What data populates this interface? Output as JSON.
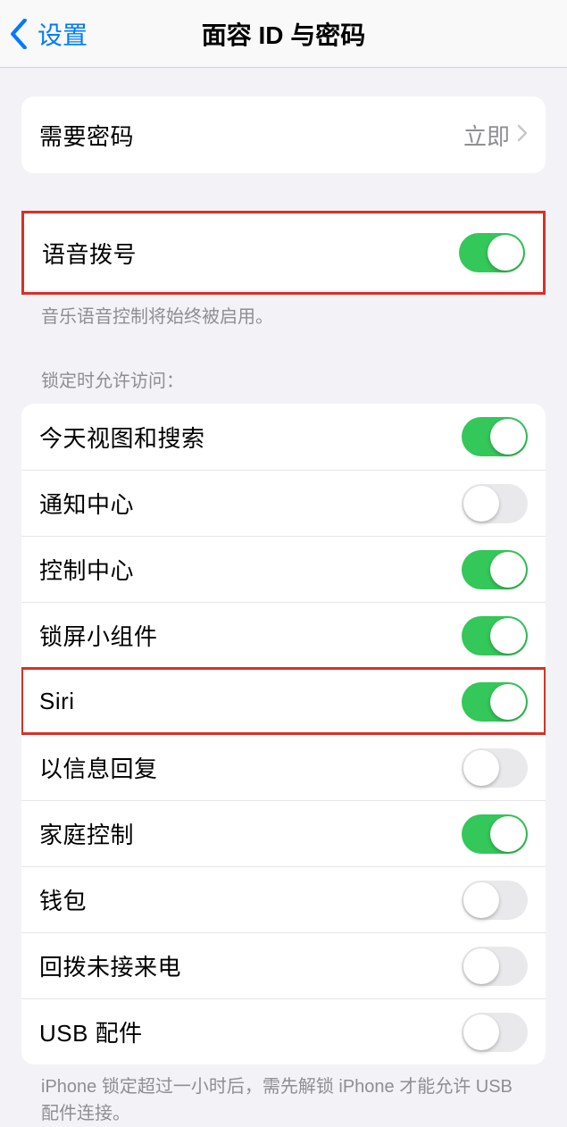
{
  "nav": {
    "back": "设置",
    "title": "面容 ID 与密码"
  },
  "passcode": {
    "label": "需要密码",
    "value": "立即"
  },
  "voice_dial": {
    "label": "语音拨号",
    "on": true,
    "footer": "音乐语音控制将始终被启用。"
  },
  "locked_access": {
    "header": "锁定时允许访问：",
    "items": [
      {
        "label": "今天视图和搜索",
        "on": true,
        "highlight": false
      },
      {
        "label": "通知中心",
        "on": false,
        "highlight": false
      },
      {
        "label": "控制中心",
        "on": true,
        "highlight": false
      },
      {
        "label": "锁屏小组件",
        "on": true,
        "highlight": false
      },
      {
        "label": "Siri",
        "on": true,
        "highlight": true
      },
      {
        "label": "以信息回复",
        "on": false,
        "highlight": false
      },
      {
        "label": "家庭控制",
        "on": true,
        "highlight": false
      },
      {
        "label": "钱包",
        "on": false,
        "highlight": false
      },
      {
        "label": "回拨未接来电",
        "on": false,
        "highlight": false
      },
      {
        "label": "USB 配件",
        "on": false,
        "highlight": false
      }
    ],
    "footer": "iPhone 锁定超过一小时后，需先解锁 iPhone 才能允许 USB 配件连接。"
  }
}
